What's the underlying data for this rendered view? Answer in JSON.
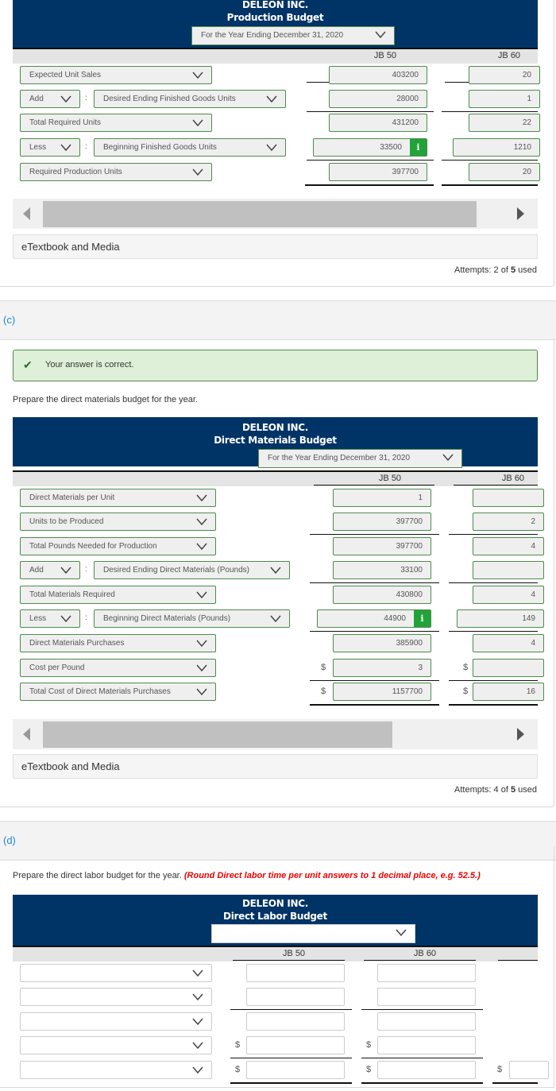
{
  "production_budget": {
    "company": "DELEON INC.",
    "title": "Production Budget",
    "period": "For the Year Ending December 31, 2020",
    "columns": [
      "JB 50",
      "JB 60"
    ],
    "rows": [
      {
        "operator": "",
        "label": "Expected Unit Sales",
        "jb50": "403200",
        "jb60": "20"
      },
      {
        "operator": "Add",
        "label": "Desired Ending Finished Goods Units",
        "jb50": "28000",
        "jb60": "1"
      },
      {
        "operator": "",
        "label": "Total Required Units",
        "jb50": "431200",
        "jb60": "22"
      },
      {
        "operator": "Less",
        "label": "Beginning Finished Goods Units",
        "jb50": "33500",
        "jb60": "1210"
      },
      {
        "operator": "",
        "label": "Required Production Units",
        "jb50": "397700",
        "jb60": "20"
      }
    ],
    "info_icon": "i",
    "etextbook": "eTextbook and Media",
    "attempts_prefix": "Attempts: 2 of ",
    "attempts_max": "5",
    "attempts_suffix": " used"
  },
  "part_c": {
    "label": "(c)",
    "feedback": "Your answer is correct.",
    "prompt": "Prepare the direct materials budget for the year.",
    "company": "DELEON INC.",
    "title": "Direct Materials Budget",
    "period": "For the Year Ending December 31, 2020",
    "columns": [
      "JB 50",
      "JB 60"
    ],
    "rows": [
      {
        "operator": "",
        "label": "Direct Materials per Unit",
        "jb50": "1",
        "jb60": "",
        "dollar": false
      },
      {
        "operator": "",
        "label": "Units to be Produced",
        "jb50": "397700",
        "jb60": "2",
        "dollar": false
      },
      {
        "operator": "",
        "label": "Total Pounds Needed for Production",
        "jb50": "397700",
        "jb60": "4",
        "dollar": false
      },
      {
        "operator": "Add",
        "label": "Desired Ending Direct Materials (Pounds)",
        "jb50": "33100",
        "jb60": "",
        "dollar": false
      },
      {
        "operator": "",
        "label": "Total Materials Required",
        "jb50": "430800",
        "jb60": "4",
        "dollar": false
      },
      {
        "operator": "Less",
        "label": "Beginning Direct Materials (Pounds)",
        "jb50": "44900",
        "jb60": "149",
        "dollar": false
      },
      {
        "operator": "",
        "label": "Direct Materials Purchases",
        "jb50": "385900",
        "jb60": "4",
        "dollar": false
      },
      {
        "operator": "",
        "label": "Cost per Pound",
        "jb50": "3",
        "jb60": "",
        "dollar": true
      },
      {
        "operator": "",
        "label": "Total Cost of Direct Materials Purchases",
        "jb50": "1157700",
        "jb60": "16",
        "dollar": true
      }
    ],
    "dollar_sign": "$",
    "info_icon": "i",
    "etextbook": "eTextbook and Media",
    "attempts_prefix": "Attempts: 4 of ",
    "attempts_max": "5",
    "attempts_suffix": " used"
  },
  "part_d": {
    "label": "(d)",
    "prompt": "Prepare the direct labor budget for the year.",
    "prompt_note": "(Round Direct labor time per unit answers to 1 decimal place, e.g. 52.5.)",
    "company": "DELEON INC.",
    "title": "Direct Labor Budget",
    "period": "",
    "columns": [
      "JB 50",
      "JB 60"
    ],
    "dollar_sign": "$"
  }
}
